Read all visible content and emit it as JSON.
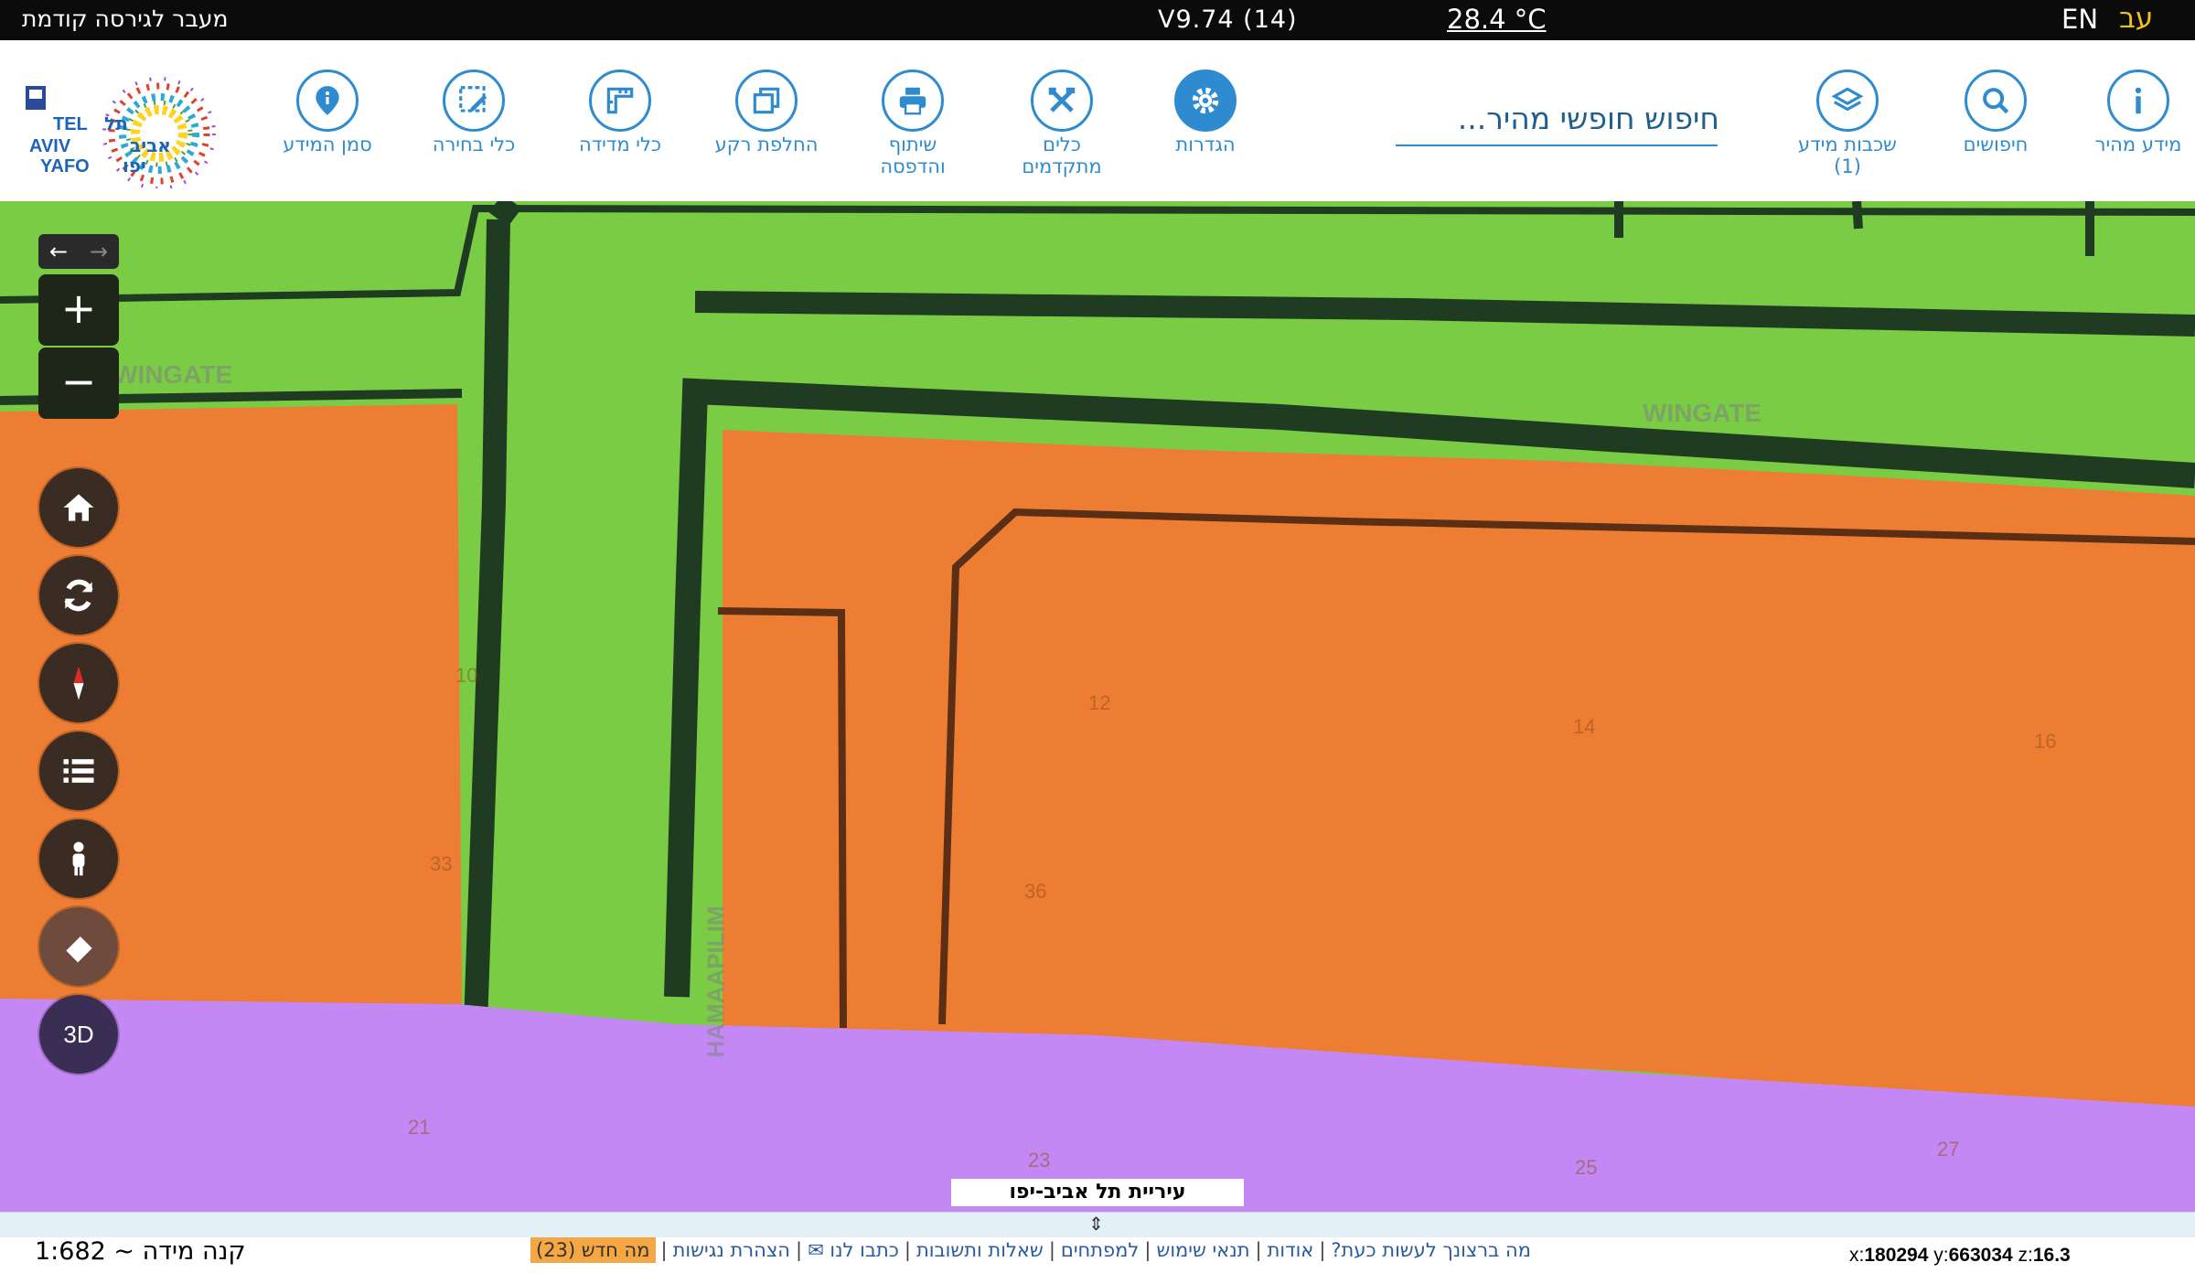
{
  "topbar": {
    "prev_version": "מעבר לגירסה קודמת",
    "version": "V9.74 (14)",
    "temperature": "28.4 °C",
    "lang_en": "EN",
    "lang_he": "עב"
  },
  "toolbar": {
    "quick_info": "מידע מהיר",
    "searches": "חיפושים",
    "layers": "שכבות מידע",
    "layers_count": "(1)",
    "search_placeholder": "חיפוש חופשי מהיר...",
    "settings": "הגדרות",
    "advanced_tools_1": "כלים",
    "advanced_tools_2": "מתקדמים",
    "share_print_1": "שיתוף",
    "share_print_2": "והדפסה",
    "switch_background": "החלפת רקע",
    "measure_tools": "כלי מדידה",
    "select_tools": "כלי בחירה",
    "info_marker": "סמן המידע"
  },
  "logo": {
    "tel": "TEL",
    "aviv": "AVIV",
    "yafo": "YAFO",
    "he_1": "תל",
    "he_2": "אביב",
    "he_3": "יפו"
  },
  "map": {
    "streets": {
      "wingate_left": "WINGATE",
      "wingate_right": "WINGATE",
      "hamaapilim": "HAMAAPILIM"
    },
    "parcels": [
      "12",
      "14",
      "16",
      "10",
      "33",
      "36",
      "21",
      "23",
      "25",
      "27"
    ],
    "controls": {
      "zoom_in": "+",
      "zoom_out": "−",
      "back": "←",
      "forward": "→",
      "three_d": "3D"
    },
    "credit": "עיריית תל אביב-יפו"
  },
  "bottom": {
    "scale": "קנה מידה ~ 1:682",
    "links": {
      "what_to_do": "מה ברצונך לעשות כעת?",
      "about": "אודות",
      "terms": "תנאי שימוש",
      "developers": "למפתחים",
      "faq": "שאלות ותשובות",
      "contact": "כתבו לנו",
      "accessibility": "הצהרת נגישות",
      "whats_new": "מה חדש (23)"
    },
    "coords": {
      "x": "180294",
      "y": "663034",
      "z": "16.3"
    }
  },
  "colors": {
    "park": "#7acc45",
    "residential": "#ed7d33",
    "public": "#c488f5",
    "accent": "#2e8bd0"
  }
}
